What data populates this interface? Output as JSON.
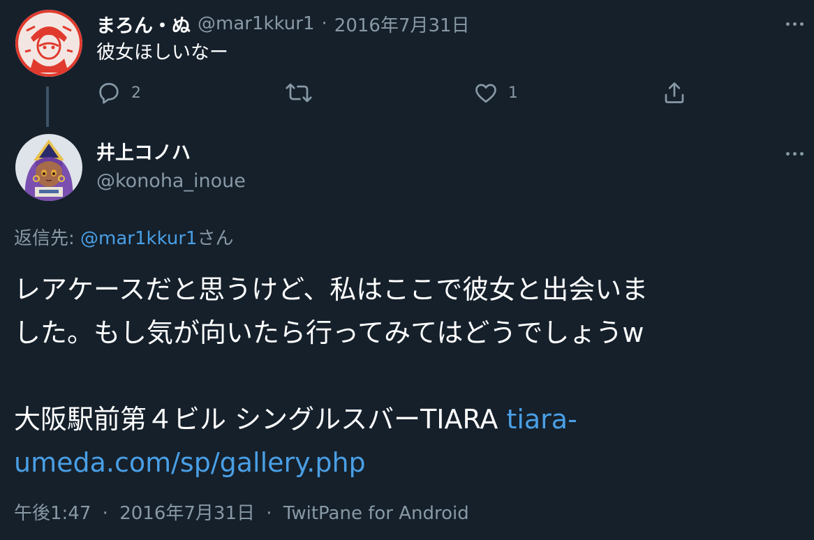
{
  "parent_tweet": {
    "display_name": "まろん・ぬ",
    "handle": "@mar1kkur1",
    "separator": "·",
    "date": "2016年7月31日",
    "text": "彼女ほしいなー",
    "avatar_icon": "red-stamp-portrait-avatar",
    "actions": {
      "reply_count": "2",
      "retweet_count": "",
      "like_count": "1"
    }
  },
  "tweet": {
    "display_name": "井上コノハ",
    "handle": "@konoha_inoue",
    "avatar_icon": "anime-character-avatar",
    "reply_prefix": "返信先: ",
    "reply_mention": "@mar1kkur1",
    "reply_suffix": "さん",
    "text_line1": "レアケースだと思うけど、私はここで彼女と出会いま",
    "text_line2": "した。もし気が向いたら行ってみてはどうでしょうw",
    "text_line3": "大阪駅前第４ビル シングルスバーTIARA ",
    "link_part1": "tiara-",
    "link_part2": "umeda.com/sp/gallery.php",
    "time": "午後1:47",
    "separator1": "·",
    "date": "2016年7月31日",
    "separator2": "·",
    "source": "TwitPane for Android"
  },
  "colors": {
    "background": "#15202b",
    "text_primary": "#ffffff",
    "text_secondary": "#8899a6",
    "link": "#4a9fe5",
    "thread_line": "#3d5466"
  }
}
